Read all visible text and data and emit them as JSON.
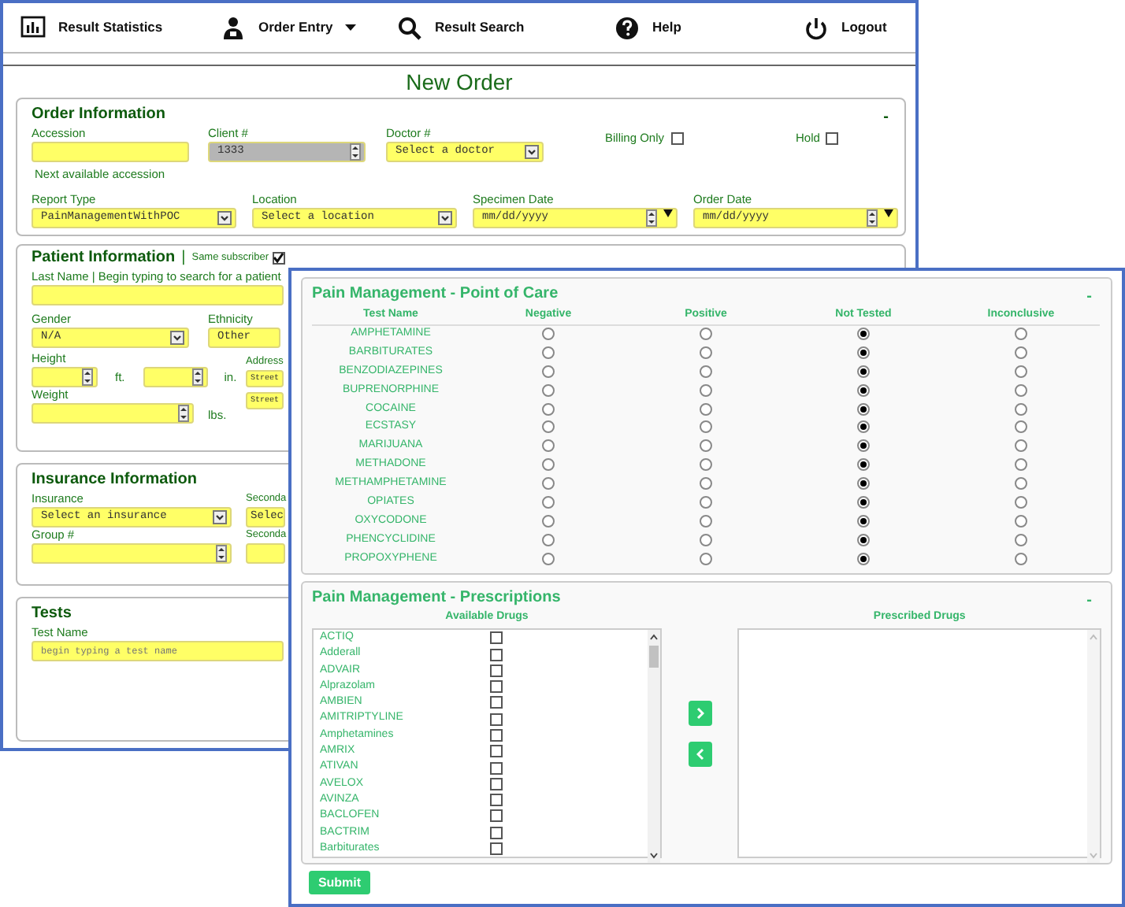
{
  "nav": [
    {
      "label": "Result Statistics",
      "dropdown": false
    },
    {
      "label": "Order Entry",
      "dropdown": true
    },
    {
      "label": "Result Search",
      "dropdown": false
    },
    {
      "label": "Help",
      "dropdown": false
    },
    {
      "label": "Logout",
      "dropdown": false
    }
  ],
  "page_title": "New Order",
  "order_information": {
    "title": "Order Information",
    "collapse": "-",
    "accession": {
      "label": "Accession"
    },
    "client": {
      "label": "Client #",
      "value": "1333",
      "disabled": true
    },
    "doctor": {
      "label": "Doctor #",
      "value": "Select a doctor"
    },
    "billing_only": {
      "label": "Billing Only",
      "checked": false
    },
    "hold": {
      "label": "Hold",
      "checked": false
    },
    "accession_hint": "Next available accession",
    "report_type": {
      "label": "Report Type",
      "value": "PainManagementWithPOC"
    },
    "location": {
      "label": "Location",
      "value": "Select a location"
    },
    "specimen_date": {
      "label": "Specimen Date",
      "value": "mm/dd/yyyy"
    },
    "order_date": {
      "label": "Order Date",
      "value": "mm/dd/yyyy"
    }
  },
  "patient_information": {
    "title": "Patient Information",
    "separator": "|",
    "same_subscriber": {
      "label": "Same subscriber",
      "checked": true
    },
    "last_name": {
      "label": "Last Name | Begin typing to search for a patient"
    },
    "gender": {
      "label": "Gender",
      "value": "N/A"
    },
    "ethnicity": {
      "label": "Ethnicity",
      "value": "Other"
    },
    "height": {
      "label": "Height",
      "feet_unit": "ft.",
      "inches_unit": "in."
    },
    "weight": {
      "label": "Weight",
      "unit": "lbs."
    },
    "address": {
      "label": "Address",
      "street_1": "Street",
      "street_2": "Street"
    }
  },
  "insurance_information": {
    "title": "Insurance Information",
    "insurance": {
      "label": "Insurance",
      "value": "Select an insurance"
    },
    "secondary": {
      "label": "Seconda",
      "value": "Selec"
    },
    "group": {
      "label": "Group #"
    },
    "secondary_group": {
      "label": "Seconda"
    }
  },
  "tests": {
    "title": "Tests",
    "test_name": {
      "label": "Test Name",
      "placeholder": "begin typing a test name"
    }
  },
  "point_of_care": {
    "title": "Pain Management - Point of Care",
    "collapse": "-",
    "columns": [
      "Test Name",
      "Negative",
      "Positive",
      "Not Tested",
      "Inconclusive"
    ],
    "rows": [
      {
        "name": "AMPHETAMINE",
        "selected": [
          false,
          false,
          true,
          false
        ]
      },
      {
        "name": "BARBITURATES",
        "selected": [
          false,
          false,
          true,
          false
        ]
      },
      {
        "name": "BENZODIAZEPINES",
        "selected": [
          false,
          false,
          true,
          false
        ]
      },
      {
        "name": "BUPRENORPHINE",
        "selected": [
          false,
          false,
          true,
          false
        ]
      },
      {
        "name": "COCAINE",
        "selected": [
          false,
          false,
          true,
          false
        ]
      },
      {
        "name": "ECSTASY",
        "selected": [
          false,
          false,
          true,
          false
        ]
      },
      {
        "name": "MARIJUANA",
        "selected": [
          false,
          false,
          true,
          false
        ]
      },
      {
        "name": "METHADONE",
        "selected": [
          false,
          false,
          true,
          false
        ]
      },
      {
        "name": "METHAMPHETAMINE",
        "selected": [
          false,
          false,
          true,
          false
        ]
      },
      {
        "name": "OPIATES",
        "selected": [
          false,
          false,
          true,
          false
        ]
      },
      {
        "name": "OXYCODONE",
        "selected": [
          false,
          false,
          true,
          false
        ]
      },
      {
        "name": "PHENCYCLIDINE",
        "selected": [
          false,
          false,
          true,
          false
        ]
      },
      {
        "name": "PROPOXYPHENE",
        "selected": [
          false,
          false,
          true,
          false
        ]
      }
    ]
  },
  "prescriptions": {
    "title": "Pain Management - Prescriptions",
    "collapse": "-",
    "available_label": "Available Drugs",
    "prescribed_label": "Prescribed Drugs",
    "available": [
      {
        "name": "ACTIQ",
        "checked": false
      },
      {
        "name": "Adderall",
        "checked": false
      },
      {
        "name": "ADVAIR",
        "checked": false
      },
      {
        "name": "Alprazolam",
        "checked": false
      },
      {
        "name": "AMBIEN",
        "checked": false
      },
      {
        "name": "AMITRIPTYLINE",
        "checked": false
      },
      {
        "name": "Amphetamines",
        "checked": false
      },
      {
        "name": "AMRIX",
        "checked": false
      },
      {
        "name": "ATIVAN",
        "checked": false
      },
      {
        "name": "AVELOX",
        "checked": false
      },
      {
        "name": "AVINZA",
        "checked": false
      },
      {
        "name": "BACLOFEN",
        "checked": false
      },
      {
        "name": "BACTRIM",
        "checked": false
      },
      {
        "name": "Barbiturates",
        "checked": false
      }
    ]
  },
  "submit": "Submit"
}
